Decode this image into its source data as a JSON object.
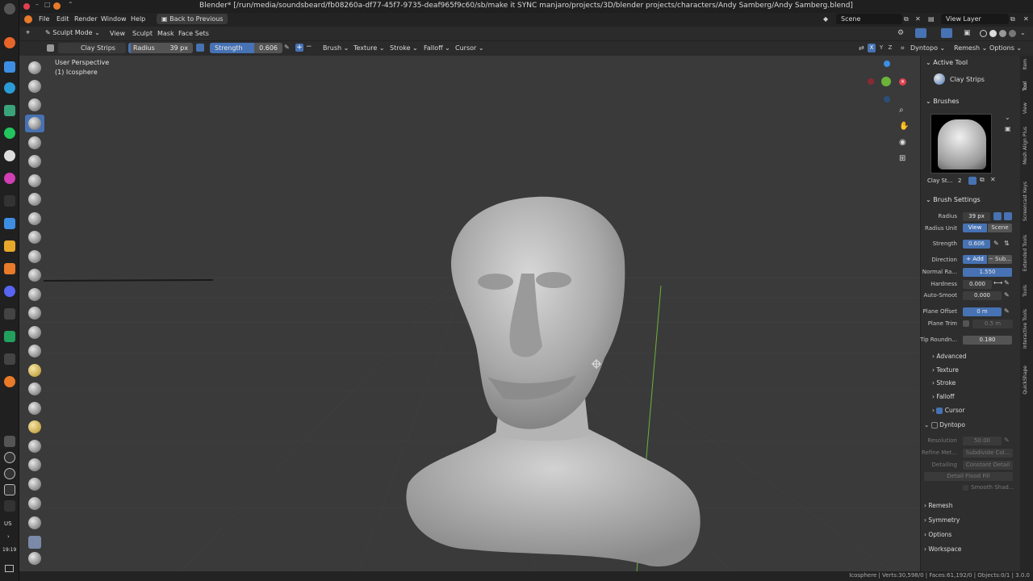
{
  "window": {
    "title": "Blender* [/run/media/soundsbeard/fb08260a-df77-45f7-9735-deaf965f9c60/sb/make it SYNC manjaro/projects/3D/blender projects/characters/Andy Samberg/Andy Samberg.blend]"
  },
  "menu": {
    "items": [
      "File",
      "Edit",
      "Render",
      "Window",
      "Help"
    ],
    "back_button": "Back to Previous",
    "scene": "Scene",
    "view_layer": "View Layer"
  },
  "header": {
    "mode": "Sculpt Mode",
    "items": [
      "View",
      "Sculpt",
      "Mask",
      "Face Sets"
    ],
    "right_items": [
      "Dyntopo",
      "Remesh",
      "Options"
    ],
    "axes": [
      "X",
      "Y",
      "Z"
    ]
  },
  "tool_settings": {
    "brush_name": "Clay Strips",
    "radius_label": "Radius",
    "radius_value": "39 px",
    "strength_label": "Strength",
    "strength_value": "0.606",
    "strength_fraction": 0.606,
    "menus": [
      "Brush",
      "Texture",
      "Stroke",
      "Falloff",
      "Cursor"
    ]
  },
  "viewport": {
    "perspective": "User Perspective",
    "object": "(1) Icosphere"
  },
  "sidebar": {
    "active_tool_head": "Active Tool",
    "active_tool_name": "Clay Strips",
    "brushes_head": "Brushes",
    "brush_slot": "Clay St...",
    "brush_users": "2",
    "brush_settings_head": "Brush Settings",
    "radius_label": "Radius",
    "radius_value": "39 px",
    "radius_unit_label": "Radius Unit",
    "radius_unit_view": "View",
    "radius_unit_scene": "Scene",
    "strength_label": "Strength",
    "strength_value": "0.606",
    "direction_label": "Direction",
    "direction_add": "Add",
    "direction_sub": "Sub...",
    "normal_label": "Normal Ra...",
    "normal_value": "1.550",
    "hardness_label": "Hardness",
    "hardness_value": "0.000",
    "autosmooth_label": "Auto-Smoot",
    "autosmooth_value": "0.000",
    "plane_offset_label": "Plane Offset",
    "plane_offset_value": "0 m",
    "plane_trim_label": "Plane Trim",
    "plane_trim_value": "0.5 m",
    "tip_label": "Tip Roundn...",
    "tip_value": "0.180",
    "sections": [
      "Advanced",
      "Texture",
      "Stroke",
      "Falloff"
    ],
    "cursor": "Cursor",
    "dyntopo_head": "Dyntopo",
    "resolution_label": "Resolution",
    "resolution_value": "50.00",
    "refine_label": "Refine Met...",
    "refine_value": "Subdivide Col...",
    "detailing_label": "Detailing",
    "detailing_value": "Constant Detail",
    "flood_fill": "Detail Flood Fill",
    "smooth_shading": "Smooth Shad...",
    "bottom_panels": [
      "Remesh",
      "Symmetry",
      "Options",
      "Workspace"
    ]
  },
  "side_tabs": [
    "Item",
    "Tool",
    "View",
    "Mesh Align Plus",
    "Screencast Keys",
    "Extended Tools",
    "Tools",
    "Interactive Tools",
    "QuickShape"
  ],
  "status": {
    "text": "Icosphere | Verts:30,598/0 | Faces:61,192/0 | Objects:0/1 | 3.0.0"
  },
  "os_dock": {
    "lang": "US",
    "time": "19:19"
  },
  "colors": {
    "accent_blue": "#4772b3",
    "viewport_bg": "#3a3a3a",
    "panel_bg": "#2e2e2e",
    "axis_x": "#e0404f",
    "axis_y": "#6cb33a",
    "axis_z": "#3d8ee3"
  }
}
